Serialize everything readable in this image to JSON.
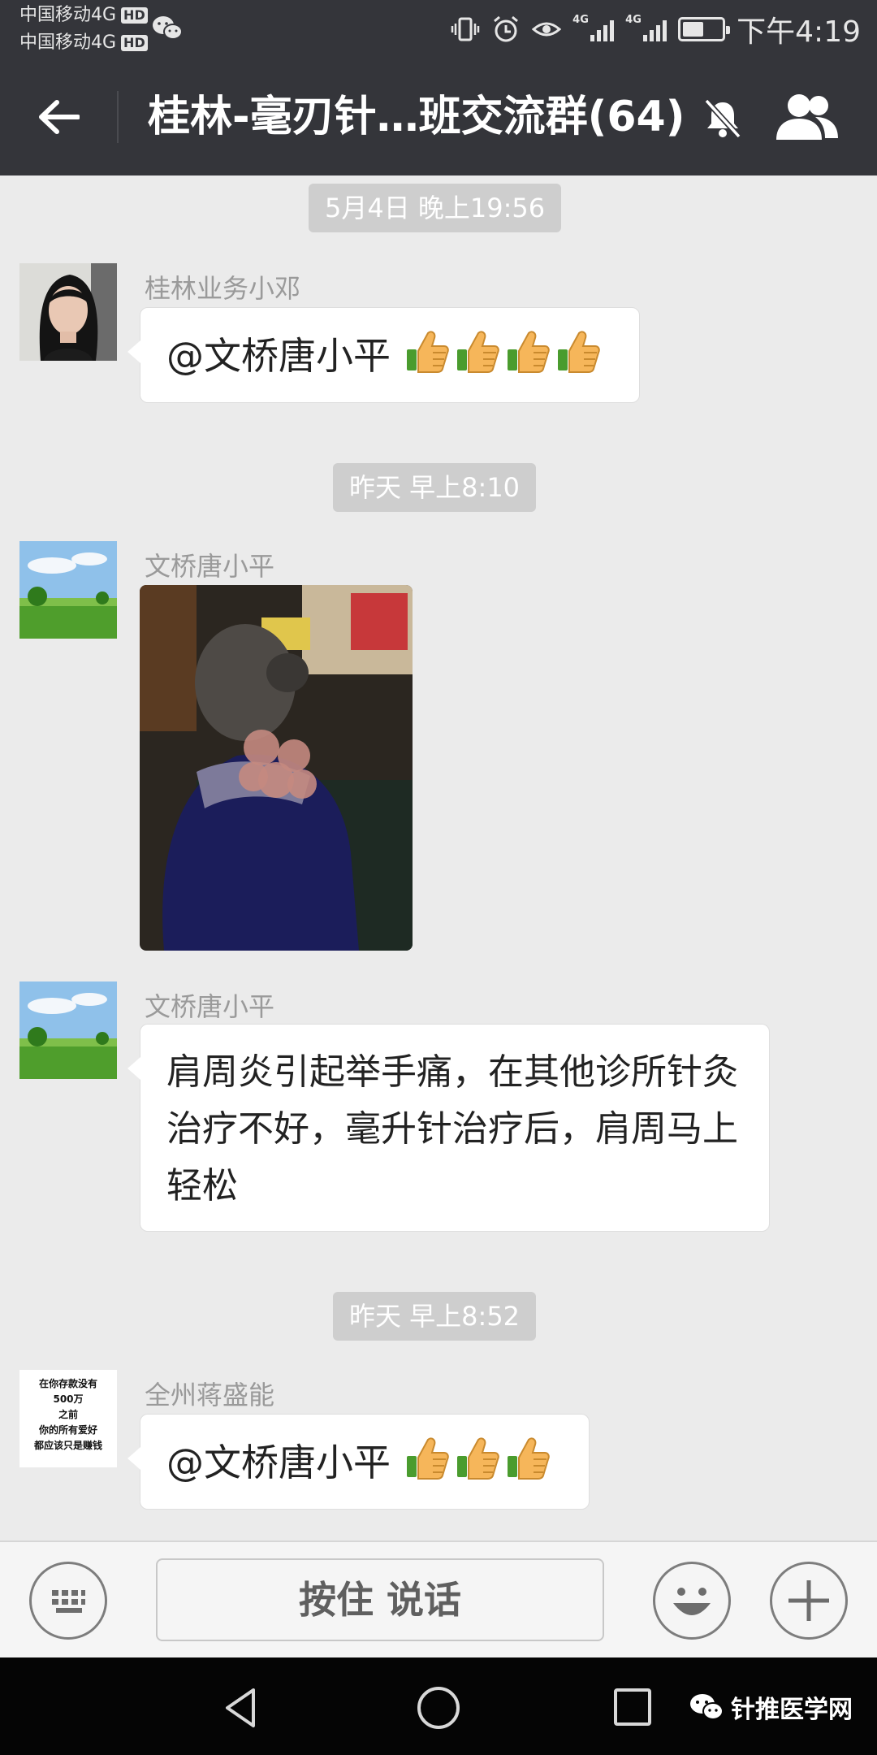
{
  "status_bar": {
    "carrier_1": "中国移动4G",
    "carrier_2": "中国移动4G",
    "hd_badge": "HD",
    "network_1": "4G",
    "network_2": "4G",
    "battery_level": 0.55,
    "time": "下午4:19"
  },
  "header": {
    "title": "桂林-毫刃针…班交流群(64)"
  },
  "messages": [
    {
      "kind": "timestamp",
      "text": "5月4日 晚上19:56"
    },
    {
      "kind": "text",
      "sender": "桂林业务小邓",
      "text": "@文桥唐小平",
      "emoji": [
        "thumbs-up",
        "thumbs-up",
        "thumbs-up",
        "thumbs-up"
      ]
    },
    {
      "kind": "timestamp",
      "text": "昨天 早上8:10"
    },
    {
      "kind": "image",
      "sender": "文桥唐小平"
    },
    {
      "kind": "text",
      "sender": "文桥唐小平",
      "text": "肩周炎引起举手痛，在其他诊所针灸治疗不好，毫升针治疗后，肩周马上轻松"
    },
    {
      "kind": "timestamp",
      "text": "昨天 早上8:52"
    },
    {
      "kind": "text",
      "sender": "全州蒋盛能",
      "text": "@文桥唐小平",
      "emoji": [
        "thumbs-up",
        "thumbs-up",
        "thumbs-up"
      ],
      "avatar_text": [
        "在你存款没有",
        "500万",
        "之前",
        "你的所有爱好",
        "都应该只是赚钱"
      ]
    }
  ],
  "input_bar": {
    "hold_to_talk_label": "按住 说话"
  },
  "nav_bar": {
    "watermark": "针推医学网"
  },
  "colors": {
    "header_bg": "#34353a",
    "chat_bg": "#ebebeb",
    "timestamp_bg": "#cecece"
  }
}
